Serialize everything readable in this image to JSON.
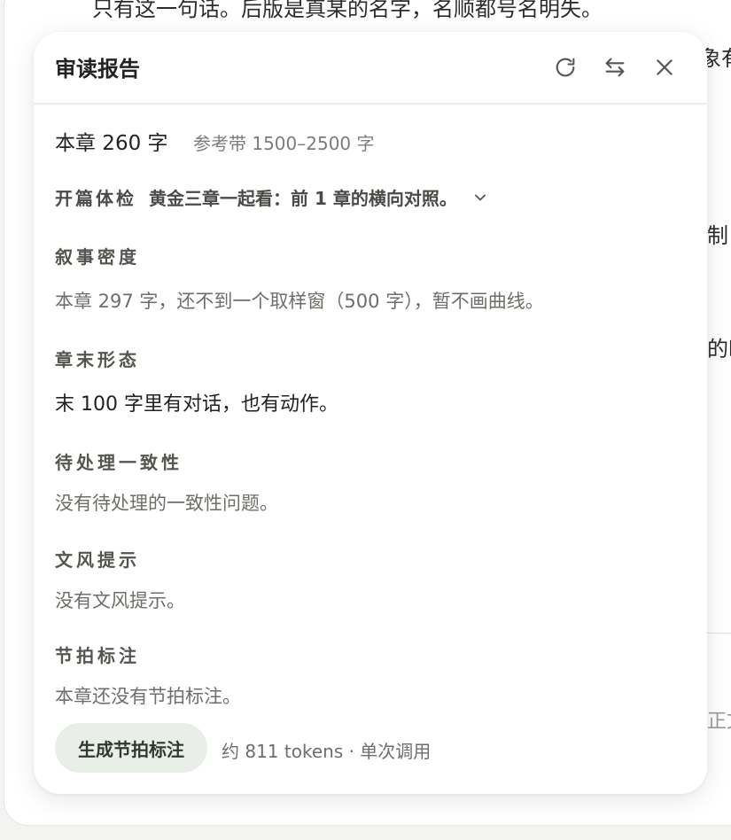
{
  "background": {
    "top_text": "只有这一句话。后版是真某的名字，名顺都号名明失。",
    "frag1": "象有",
    "frag2": "制",
    "frag3": "的时",
    "frag4": "正文"
  },
  "panel": {
    "title": "审读报告",
    "icons": {
      "refresh": "refresh-icon",
      "swap": "swap-arrows-icon",
      "close": "close-icon"
    },
    "word_count": "本章 260 字",
    "word_ref": "参考带 1500–2500 字",
    "opening": {
      "label": "开篇体检",
      "desc": "黄金三章一起看：前 1 章的横向对照。"
    },
    "sections": [
      {
        "label": "叙事密度",
        "text": "本章 297 字，还不到一个取样窗（500 字），暂不画曲线。"
      },
      {
        "label": "章末形态",
        "text": "末 100 字里有对话，也有动作。"
      },
      {
        "label": "待处理一致性",
        "text": "没有待处理的一致性问题。"
      },
      {
        "label": "文风提示",
        "text": "没有文风提示。"
      },
      {
        "label": "节拍标注",
        "text": "本章还没有节拍标注。"
      }
    ],
    "generate_button": "生成节拍标注",
    "token_note": "约 811 tokens · 单次调用"
  },
  "colors": {
    "accent_button_bg": "#e9efe8",
    "panel_bg": "#ffffff",
    "page_bg": "#f3f3f1"
  }
}
